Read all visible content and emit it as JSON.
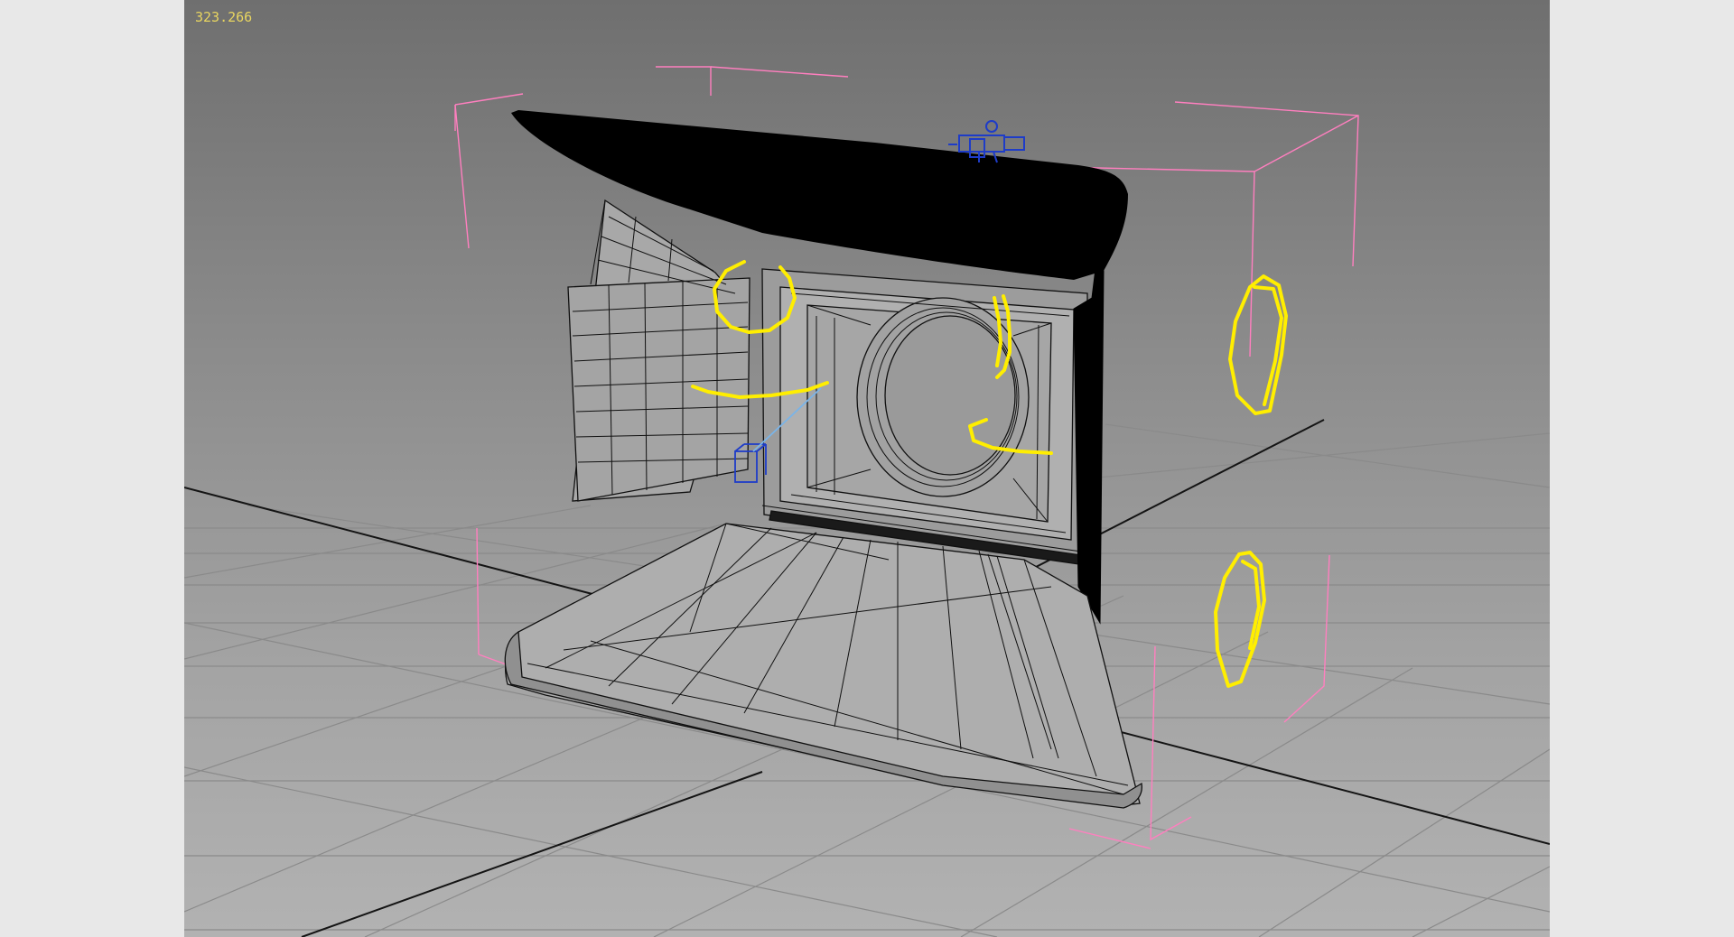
{
  "viewport": {
    "readout": "323.266",
    "colors": {
      "background_top": "#6f6f6f",
      "background_bottom": "#b2b2b2",
      "grid": "#8a8a8a",
      "axis": "#141414",
      "bounding_box": "#ff7fbf",
      "spline_selection": "#ffee00",
      "helper": "#1e3cc8",
      "mesh_fill": "#a8a8a8",
      "wireframe": "#101010"
    },
    "icons": [
      "light-helper-icon",
      "dummy-helper-icon"
    ]
  }
}
